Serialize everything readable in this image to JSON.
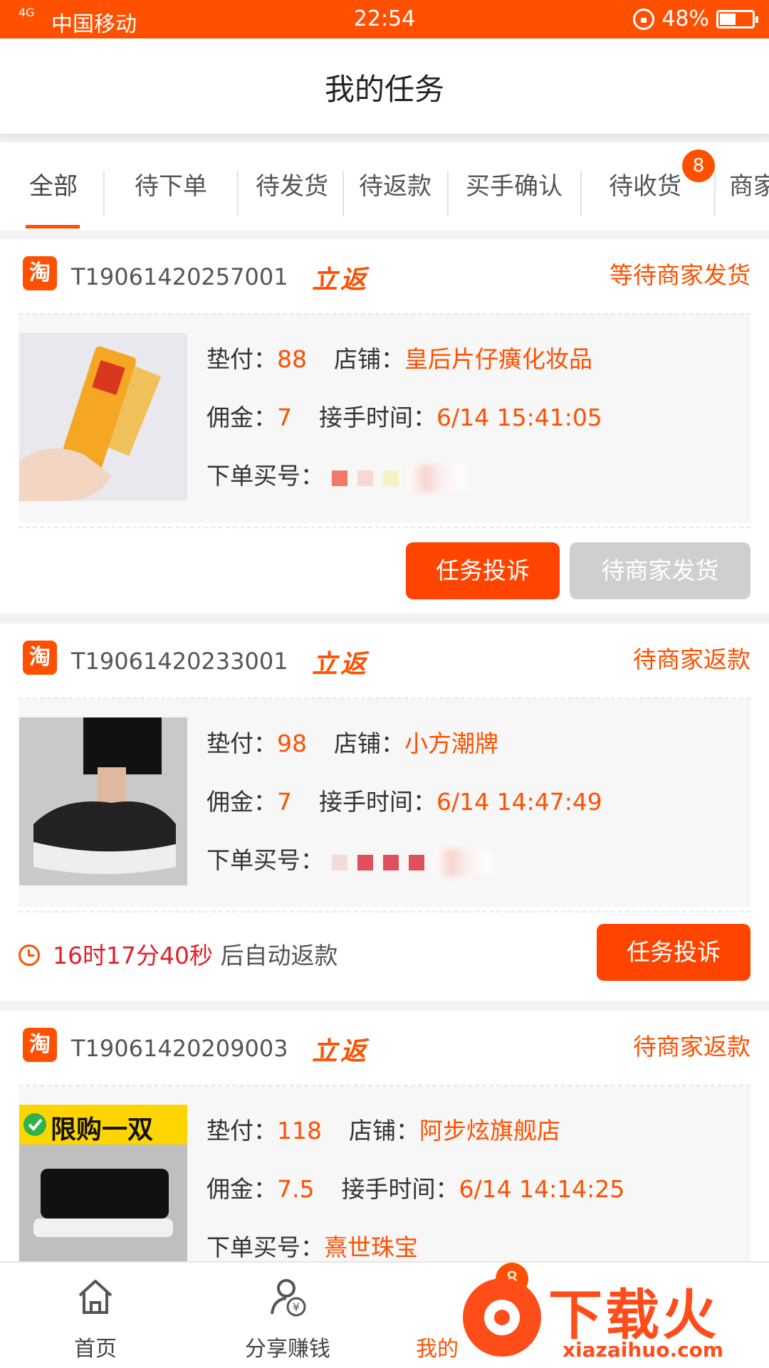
{
  "status_bar": {
    "signal": "4G",
    "carrier": "中国移动",
    "time": "22:54",
    "battery": "48%"
  },
  "header": {
    "title": "我的任务"
  },
  "tabs": [
    {
      "label": "全部",
      "active": true
    },
    {
      "label": "待下单"
    },
    {
      "label": "待发货"
    },
    {
      "label": "待返款"
    },
    {
      "label": "买手确认"
    },
    {
      "label": "待收货",
      "badge": "8"
    },
    {
      "label": "商家"
    }
  ],
  "cards": [
    {
      "platform_icon": "淘",
      "task_no": "T19061420257001",
      "tag": "立返",
      "status": "等待商家发货",
      "advance_label": "垫付：",
      "advance": "88",
      "shop_label": "店铺：",
      "shop": "皇后片仔癀化妆品",
      "commission_label": "佣金：",
      "commission": "7",
      "accept_time_label": "接手时间：",
      "accept_time": "6/14 15:41:05",
      "buyer_label": "下单买号：",
      "buttons": [
        "任务投诉",
        "待商家发货"
      ]
    },
    {
      "platform_icon": "淘",
      "task_no": "T19061420233001",
      "tag": "立返",
      "status": "待商家返款",
      "advance_label": "垫付：",
      "advance": "98",
      "shop_label": "店铺：",
      "shop": "小方潮牌",
      "commission_label": "佣金：",
      "commission": "7",
      "accept_time_label": "接手时间：",
      "accept_time": "6/14 14:47:49",
      "buyer_label": "下单买号：",
      "countdown": "16时17分40秒",
      "countdown_suffix": " 后自动返款",
      "buttons": [
        "任务投诉"
      ]
    },
    {
      "platform_icon": "淘",
      "task_no": "T19061420209003",
      "tag": "立返",
      "status": "待商家返款",
      "advance_label": "垫付：",
      "advance": "118",
      "shop_label": "店铺：",
      "shop": "阿步炫旗舰店",
      "commission_label": "佣金：",
      "commission": "7.5",
      "accept_time_label": "接手时间：",
      "accept_time": "6/14 14:14:25",
      "buyer_label": "下单买号：",
      "buyer": "熹世珠宝",
      "image_badge": "限购一双"
    }
  ],
  "bottom_nav": [
    {
      "label": "首页",
      "icon": "home-icon"
    },
    {
      "label": "分享赚钱",
      "icon": "share-money-icon"
    },
    {
      "label": "我的",
      "icon": "user-icon",
      "badge": "8"
    }
  ],
  "watermark": {
    "brand": "下载火",
    "url": "xiazaihuo.com"
  },
  "colors": {
    "accent": "#ff5000",
    "button": "#ff4400",
    "countdown": "#e0202b"
  }
}
